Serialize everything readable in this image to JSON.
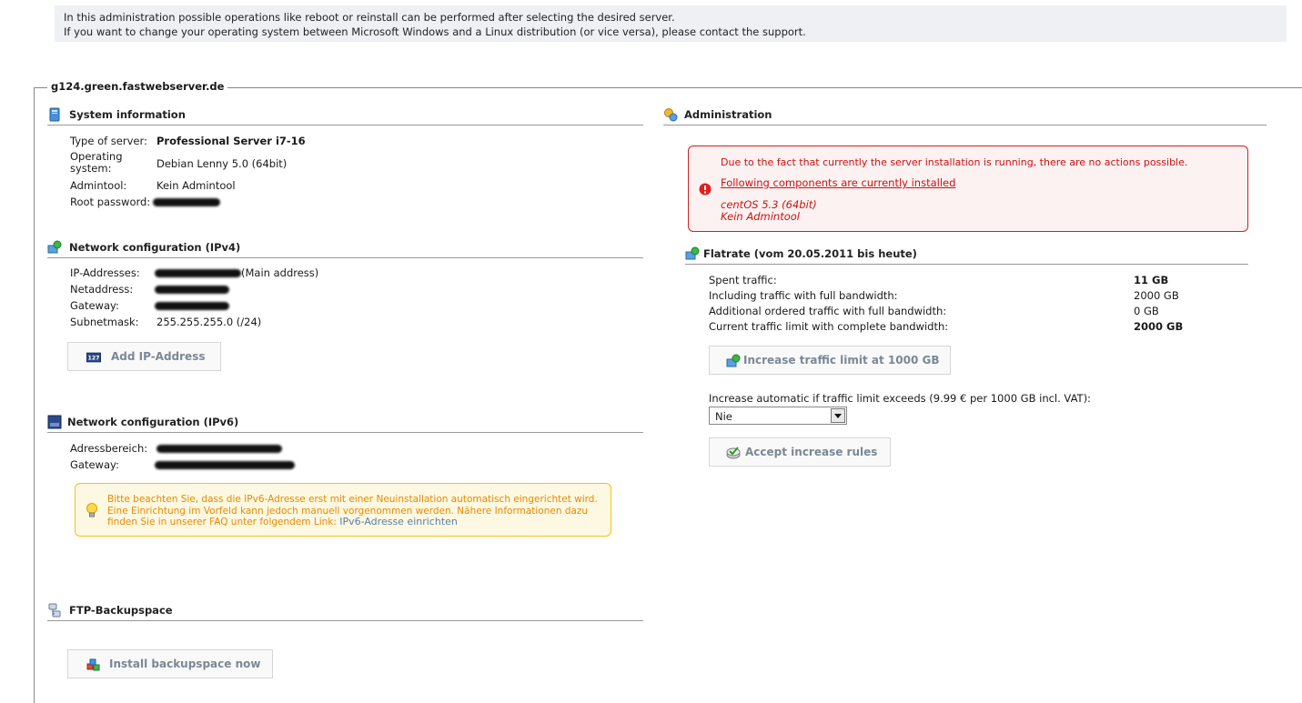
{
  "top_info": {
    "line1": "In this administration possible operations like reboot or reinstall can be performed after selecting the desired server.",
    "line2": "If you want to change your operating system between Microsoft Windows and a Linux distribution (or vice versa), please contact the support."
  },
  "server_name": "g124.green.fastwebserver.de",
  "system_info": {
    "title": "System information",
    "type_label": "Type of server:",
    "type_value": "Professional Server i7-16",
    "os_label_1": "Operating",
    "os_label_2": "system:",
    "os_value": "Debian Lenny 5.0 (64bit)",
    "admintool_label": "Admintool:",
    "admintool_value": "Kein Admintool",
    "root_label": "Root password:"
  },
  "ipv4": {
    "title": "Network configuration (IPv4)",
    "ip_label": "IP-Addresses:",
    "ip_suffix": "(Main address)",
    "netaddress_label": "Netaddress:",
    "gateway_label": "Gateway:",
    "subnet_label": "Subnetmask:",
    "subnet_value": "255.255.255.0 (/24)",
    "add_button": "Add IP-Address",
    "add_icon_text": "127"
  },
  "ipv6": {
    "title": "Network configuration (IPv6)",
    "range_label": "Adressbereich:",
    "gateway_label": "Gateway:",
    "hint_text": "Bitte beachten Sie, dass die IPv6-Adresse erst mit einer Neuinstallation automatisch eingerichtet wird. Eine Einrichtung im Vorfeld kann jedoch manuell vorgenommen werden. Nähere Informationen dazu finden Sie in unserer FAQ unter folgendem Link:",
    "hint_link": "IPv6-Adresse einrichten"
  },
  "ftp": {
    "title": "FTP-Backupspace",
    "install_button": "Install backupspace now"
  },
  "administration": {
    "title": "Administration",
    "error_msg": "Due to the fact that currently the server installation is running, there are no actions possible.",
    "components_link": "Following components are currently installed",
    "component_1": "centOS 5.3 (64bit)",
    "component_2": "Kein Admintool"
  },
  "flatrate": {
    "title": "Flatrate (vom 20.05.2011 bis heute)",
    "rows": [
      {
        "label": "Spent traffic:",
        "value": "11 GB"
      },
      {
        "label": "Including traffic with full bandwidth:",
        "value": "2000 GB"
      },
      {
        "label": "Additional ordered traffic with full bandwidth:",
        "value": "0 GB"
      },
      {
        "label": "Current traffic limit with complete bandwidth:",
        "value": "2000 GB"
      }
    ],
    "increase_button": "Increase traffic limit at 1000 GB",
    "auto_label": "Increase automatic if traffic limit exceeds (9.99 € per 1000 GB incl. VAT):",
    "auto_select_value": "Nie",
    "accept_button": "Accept increase rules"
  },
  "colors": {
    "error": "#cc1111",
    "hint": "#e88a00",
    "link": "#5b7fa8",
    "button_text": "#7a8896"
  }
}
